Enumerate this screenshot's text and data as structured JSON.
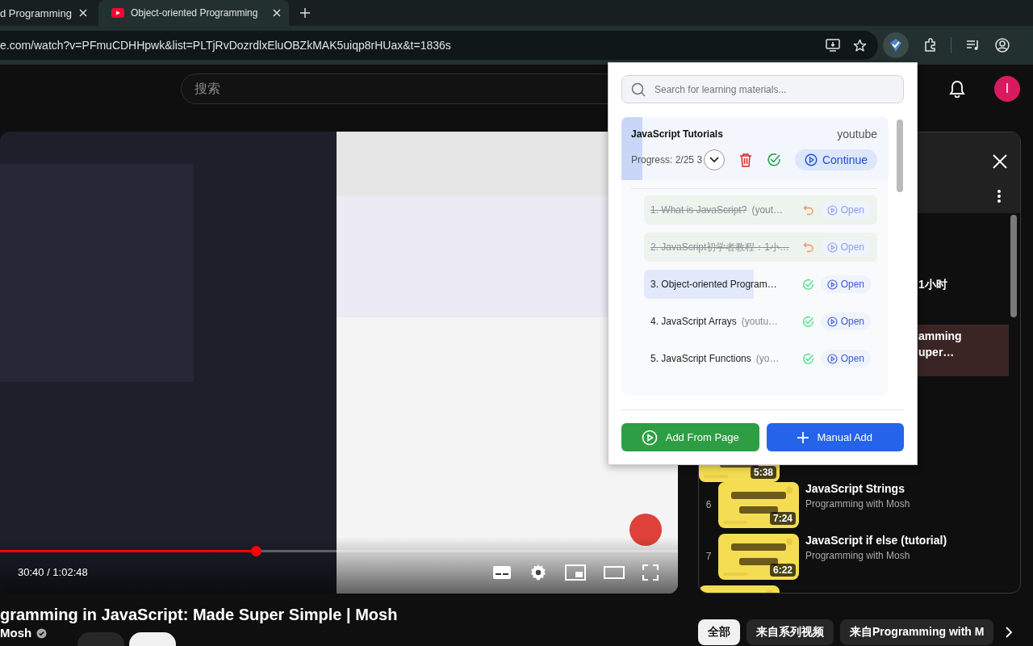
{
  "browser": {
    "tabs": [
      {
        "title": "d Programming",
        "selected": false,
        "favicon": false
      },
      {
        "title": "Object-oriented Programming",
        "selected": true,
        "favicon": true
      }
    ],
    "url": "e.com/watch?v=PFmuCDHHpwk&list=PLTjRvDozrdlxEluOBZkMAK5uiqp8rHUax&t=1836s"
  },
  "youtube": {
    "search": {
      "placeholder": "搜索"
    },
    "avatar": "I",
    "player": {
      "level": 0.377,
      "time": "30:40 / 1:02:48"
    },
    "title": "gramming in JavaScript: Made Super Simple | Mosh",
    "channel": "Mosh"
  },
  "playlist": {
    "items": [
      {
        "kind": "partial",
        "lines": [
          "1小时"
        ],
        "selected": false
      },
      {
        "kind": "partial",
        "lines": [
          "amming",
          "uper…"
        ],
        "selected": true
      },
      {
        "kind": "thumb",
        "duration": "5:38",
        "selected": false
      },
      {
        "kind": "full",
        "index": "6",
        "title": "JavaScript Strings",
        "channel": "Programming with Mosh",
        "duration": "7:24",
        "selected": false
      },
      {
        "kind": "full",
        "index": "7",
        "title": "JavaScript if else (tutorial)",
        "channel": "Programming with Mosh",
        "duration": "6:22",
        "selected": false
      },
      {
        "kind": "thumb",
        "selected": false
      }
    ]
  },
  "chips": [
    {
      "label": "全部",
      "selected": true
    },
    {
      "label": "来自系列视频",
      "selected": false
    },
    {
      "label": "来自Programming with M",
      "selected": false
    }
  ],
  "popup": {
    "search": {
      "placeholder": "Search for learning materials..."
    },
    "collection": {
      "title": "JavaScript Tutorials",
      "source": "youtube",
      "progress": "Progress: 2/25 3",
      "level": 0.08,
      "continue": "Continue",
      "items": [
        {
          "title": "1. What is JavaScript?",
          "source": "(yout…",
          "done": true,
          "action": "Open"
        },
        {
          "title": "2. JavaScript初学者教程：1小…",
          "done": true,
          "action": "Open"
        },
        {
          "title": "3. Object-oriented Program…",
          "done": false,
          "level": 0.47,
          "action": "Open"
        },
        {
          "title": "4. JavaScript Arrays",
          "source": "(youtu…",
          "done": false,
          "action": "Open"
        },
        {
          "title": "5. JavaScript Functions",
          "source": "(yo…",
          "done": false,
          "action": "Open"
        }
      ]
    },
    "buttons": [
      {
        "kind": "from-page",
        "label": "Add From Page"
      },
      {
        "kind": "manual",
        "label": "Manual Add"
      }
    ]
  }
}
